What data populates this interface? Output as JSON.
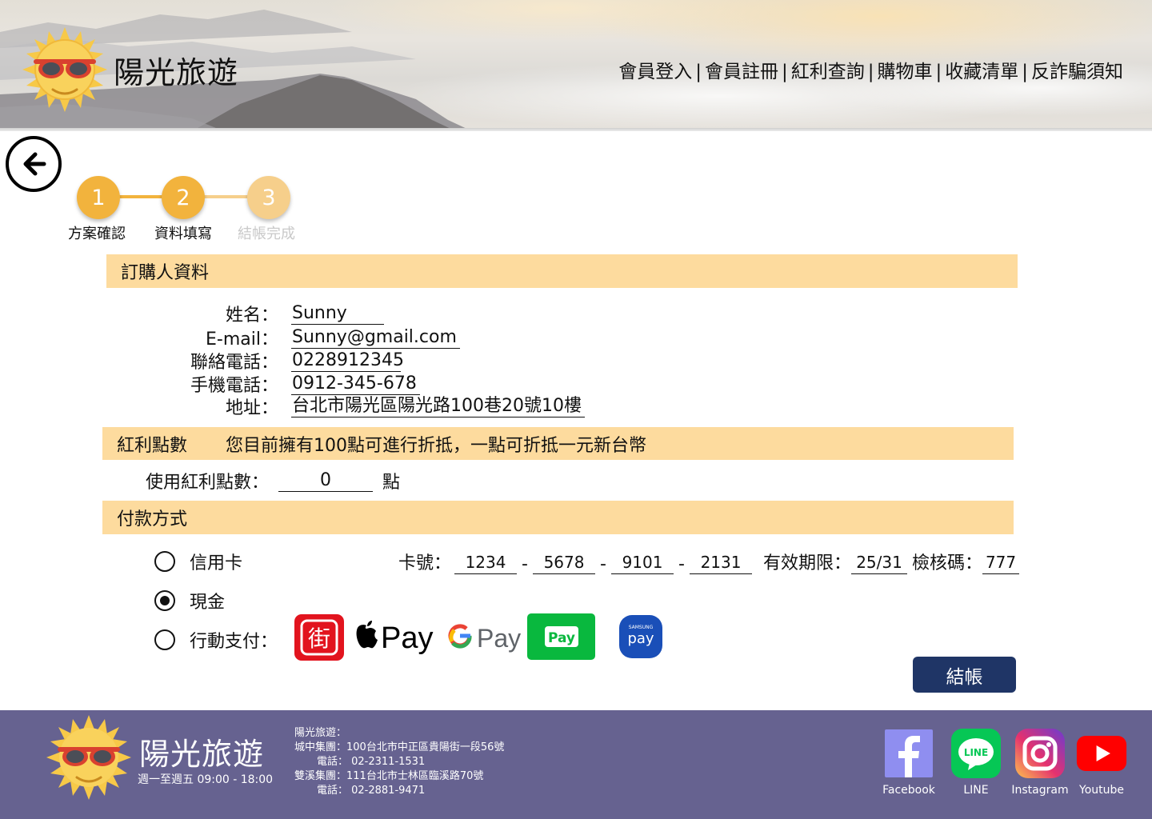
{
  "header": {
    "brand": "陽光旅遊",
    "nav": [
      {
        "label": "會員登入"
      },
      {
        "label": "會員註冊"
      },
      {
        "label": "紅利查詢"
      },
      {
        "label": "購物車"
      },
      {
        "label": "收藏清單"
      },
      {
        "label": "反詐騙須知"
      }
    ],
    "separator": "|"
  },
  "back": {
    "icon": "arrow-left-icon"
  },
  "steps": [
    {
      "number": "1",
      "label": "方案確認",
      "state": "done"
    },
    {
      "number": "2",
      "label": "資料填寫",
      "state": "current"
    },
    {
      "number": "3",
      "label": "結帳完成",
      "state": "pending"
    }
  ],
  "orderer": {
    "title": "訂購人資料",
    "fields": [
      {
        "label": "姓名：",
        "value": "Sunny"
      },
      {
        "label": "E-mail：",
        "value": "Sunny@gmail.com"
      },
      {
        "label": "聯絡電話：",
        "value": "0228912345"
      },
      {
        "label": "手機電話：",
        "value": "0912-345-678"
      },
      {
        "label": "地址：",
        "value": "台北市陽光區陽光路100巷20號10樓"
      }
    ]
  },
  "points": {
    "title": "紅利點數",
    "message": "您目前擁有100點可進行折抵，一點可折抵一元新台幣",
    "use_label": "使用紅利點數：",
    "value": "0",
    "unit": "點"
  },
  "payment": {
    "title": "付款方式",
    "options": [
      {
        "label": "信用卡",
        "selected": false
      },
      {
        "label": "現金",
        "selected": true
      },
      {
        "label": "行動支付：",
        "selected": false
      }
    ],
    "card": {
      "number_label": "卡號：",
      "segments": [
        "1234",
        "5678",
        "9101",
        "2131"
      ],
      "expiry_label": "有效期限：",
      "expiry": "25/31",
      "cvv_label": "檢核碼：",
      "cvv": "777"
    },
    "mobile_methods": [
      {
        "icon": "jkopay-icon",
        "glyph": "街"
      },
      {
        "icon": "apple-pay-icon",
        "text": "Pay"
      },
      {
        "icon": "google-pay-icon",
        "text": "Pay"
      },
      {
        "icon": "line-pay-icon",
        "text": "Pay"
      },
      {
        "icon": "samsung-pay-icon",
        "text": "pay",
        "small": "SAMSUNG"
      }
    ]
  },
  "checkout_label": "結帳",
  "footer": {
    "brand": "陽光旅遊",
    "hours": "週一至週五 09:00 - 18:00",
    "info": [
      "陽光旅遊：",
      "城中集團：100台北市中正區貴陽街一段56號",
      "電話： 02-2311-1531",
      "雙溪集團：111台北市士林區臨溪路70號",
      "電話： 02-2881-9471"
    ],
    "social": [
      {
        "label": "Facebook",
        "icon": "facebook-icon"
      },
      {
        "label": "LINE",
        "icon": "line-icon"
      },
      {
        "label": "Instagram",
        "icon": "instagram-icon"
      },
      {
        "label": "Youtube",
        "icon": "youtube-icon"
      }
    ]
  },
  "colors": {
    "section_bar": "#fddb9e",
    "step_active": "#f2b33d",
    "step_pending": "#f6cf8b",
    "checkout": "#1f3566",
    "footer": "#666290"
  }
}
